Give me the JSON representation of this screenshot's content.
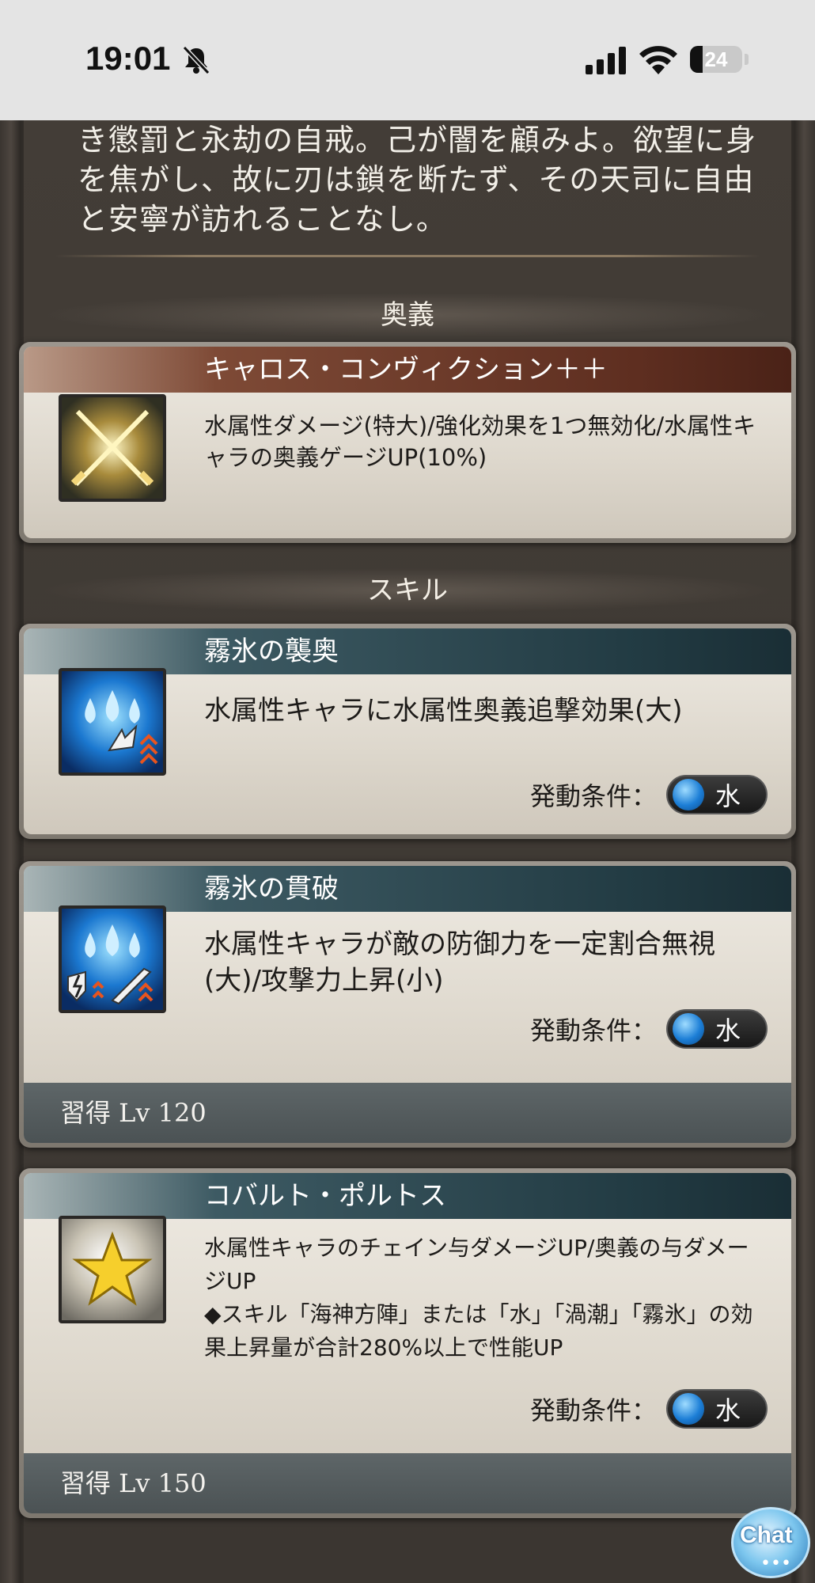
{
  "status_bar": {
    "time": "19:01",
    "battery": "24",
    "battery_level": 0.24
  },
  "lore_text": "き懲罰と永劫の自戒。己が闇を顧みよ。欲望に身を焦がし、故に刃は鎖を断たず、その天司に自由と安寧が訪れることなし。",
  "sections": {
    "ougi": "奥義",
    "skill": "スキル"
  },
  "ougi_card": {
    "title": "キャロス・コンヴィクション＋＋",
    "description": "水属性ダメージ(特大)/強化効果を1つ無効化/水属性キャラの奥義ゲージUP(10%)",
    "icon": "crossed-swords-icon"
  },
  "skills": [
    {
      "title": "霧氷の襲奥",
      "description": "水属性キャラに水属性奥義追撃効果(大)",
      "condition_label": "発動条件：",
      "condition_value": "水",
      "icon": "water-ougi-echo-icon"
    },
    {
      "title": "霧氷の貫破",
      "description": "水属性キャラが敵の防御力を一定割合無視(大)/攻撃力上昇(小)",
      "condition_label": "発動条件：",
      "condition_value": "水",
      "learn": "習得 Lv 120",
      "icon": "water-def-ignore-icon"
    },
    {
      "title": "コバルト・ポルトス",
      "description": "水属性キャラのチェイン与ダメージUP/奥義の与ダメージUP",
      "description2": "◆スキル「海神方陣」または「水」「渦潮」「霧氷」の効果上昇量が合計280%以上で性能UP",
      "condition_label": "発動条件：",
      "condition_value": "水",
      "learn": "習得 Lv 150",
      "icon": "star-icon"
    }
  ],
  "chat_button": "Chat",
  "colors": {
    "ougi_title_bar": "#5e2e20",
    "skill_title_bar": "#223b43",
    "water_accent": "#1c7ed6"
  }
}
